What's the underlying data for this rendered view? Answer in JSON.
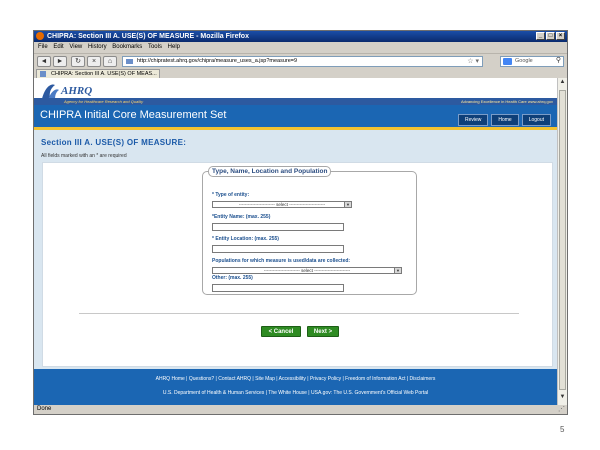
{
  "browser": {
    "window_title": "CHIPRA: Section III A. USE(S) OF MEASURE - Mozilla Firefox",
    "menu": [
      "File",
      "Edit",
      "View",
      "History",
      "Bookmarks",
      "Tools",
      "Help"
    ],
    "url": "http://chipratest.ahrq.gov/chipra/measure_uses_a.jsp?measure=9",
    "search_placeholder": "Google",
    "tab_label": "CHIPRA: Section III A. USE(S) OF MEAS...",
    "status": "Done"
  },
  "site": {
    "logo_text": "AHRQ",
    "tagline": "Agency for Healthcare Research and Quality",
    "slogan": "Advancing Excellence in Health Care   www.ahrq.gov",
    "app_title": "CHIPRA Initial Core Measurement Set",
    "nav": [
      "Review",
      "Home",
      "Logout"
    ]
  },
  "page": {
    "section_title": "Section III A. USE(S) OF MEASURE:",
    "required_note": "All fields marked with an * are required",
    "fieldset_title": "Type, Name, Location and Population",
    "fields": {
      "type_label": "* Type of entity:",
      "type_value": "------------------------ select ------------------------",
      "name_label": "*Entity Name: (max. 255)",
      "location_label": "* Entity Location: (max. 255)",
      "populations_label": "Populations for which measure is used/data are collected:",
      "populations_value": "------------------------ select ------------------------",
      "other_label": "Other: (max. 255)"
    },
    "cancel_label": "< Cancel",
    "next_label": "Next >"
  },
  "footer": {
    "row1": "AHRQ Home | Questions? | Contact AHRQ | Site Map | Accessibility | Privacy Policy | Freedom of Information Act | Disclaimers",
    "row2": "U.S. Department of Health & Human Services | The White House | USA.gov: The U.S. Government's Official Web Portal"
  },
  "slide_number": "5"
}
